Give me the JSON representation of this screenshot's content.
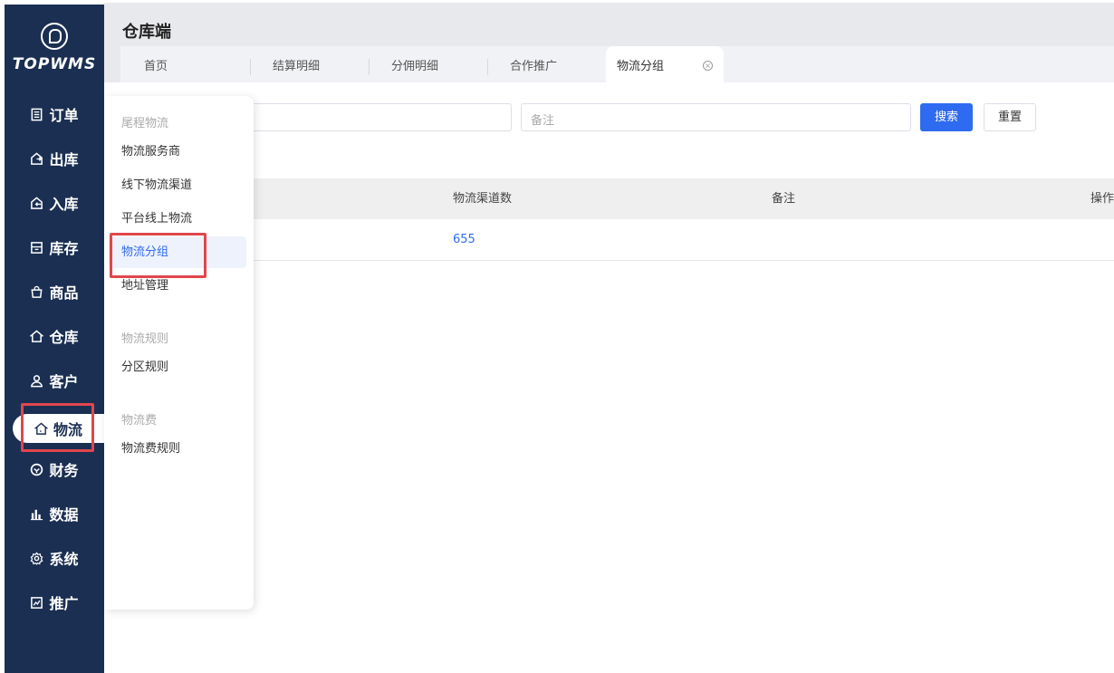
{
  "sidebar": {
    "logo_text": "TOPWMS",
    "items": [
      {
        "label": "订单",
        "icon": "order-icon"
      },
      {
        "label": "出库",
        "icon": "outbound-icon"
      },
      {
        "label": "入库",
        "icon": "inbound-icon"
      },
      {
        "label": "库存",
        "icon": "inventory-icon"
      },
      {
        "label": "商品",
        "icon": "goods-icon"
      },
      {
        "label": "仓库",
        "icon": "warehouse-icon"
      },
      {
        "label": "客户",
        "icon": "customer-icon"
      },
      {
        "label": "物流",
        "icon": "logistics-icon"
      },
      {
        "label": "财务",
        "icon": "finance-icon"
      },
      {
        "label": "数据",
        "icon": "data-icon"
      },
      {
        "label": "系统",
        "icon": "settings-icon"
      },
      {
        "label": "推广",
        "icon": "promotion-icon"
      }
    ],
    "active_label": "物流"
  },
  "header": {
    "title": "仓库端",
    "tabs": [
      {
        "label": "首页"
      },
      {
        "label": "结算明细"
      },
      {
        "label": "分佣明细"
      },
      {
        "label": "合作推广"
      },
      {
        "label": "物流分组",
        "active": true
      }
    ]
  },
  "filters": {
    "remark_placeholder": "备注",
    "search_label": "搜索",
    "reset_label": "重置"
  },
  "table": {
    "columns": [
      "物流渠道数",
      "备注",
      "操作"
    ],
    "rows": [
      {
        "channel_count": "655",
        "remark": ""
      }
    ]
  },
  "dropdown": {
    "groups": [
      {
        "title": "尾程物流",
        "items": [
          "物流服务商",
          "线下物流渠道",
          "平台线上物流",
          "物流分组",
          "地址管理"
        ]
      },
      {
        "title": "物流规则",
        "items": [
          "分区规则"
        ]
      },
      {
        "title": "物流费",
        "items": [
          "物流费规则"
        ]
      }
    ],
    "selected": "物流分组"
  },
  "colors": {
    "sidebar_bg": "#1b2f52",
    "accent": "#2f6bf0",
    "highlight": "#e0474c"
  }
}
